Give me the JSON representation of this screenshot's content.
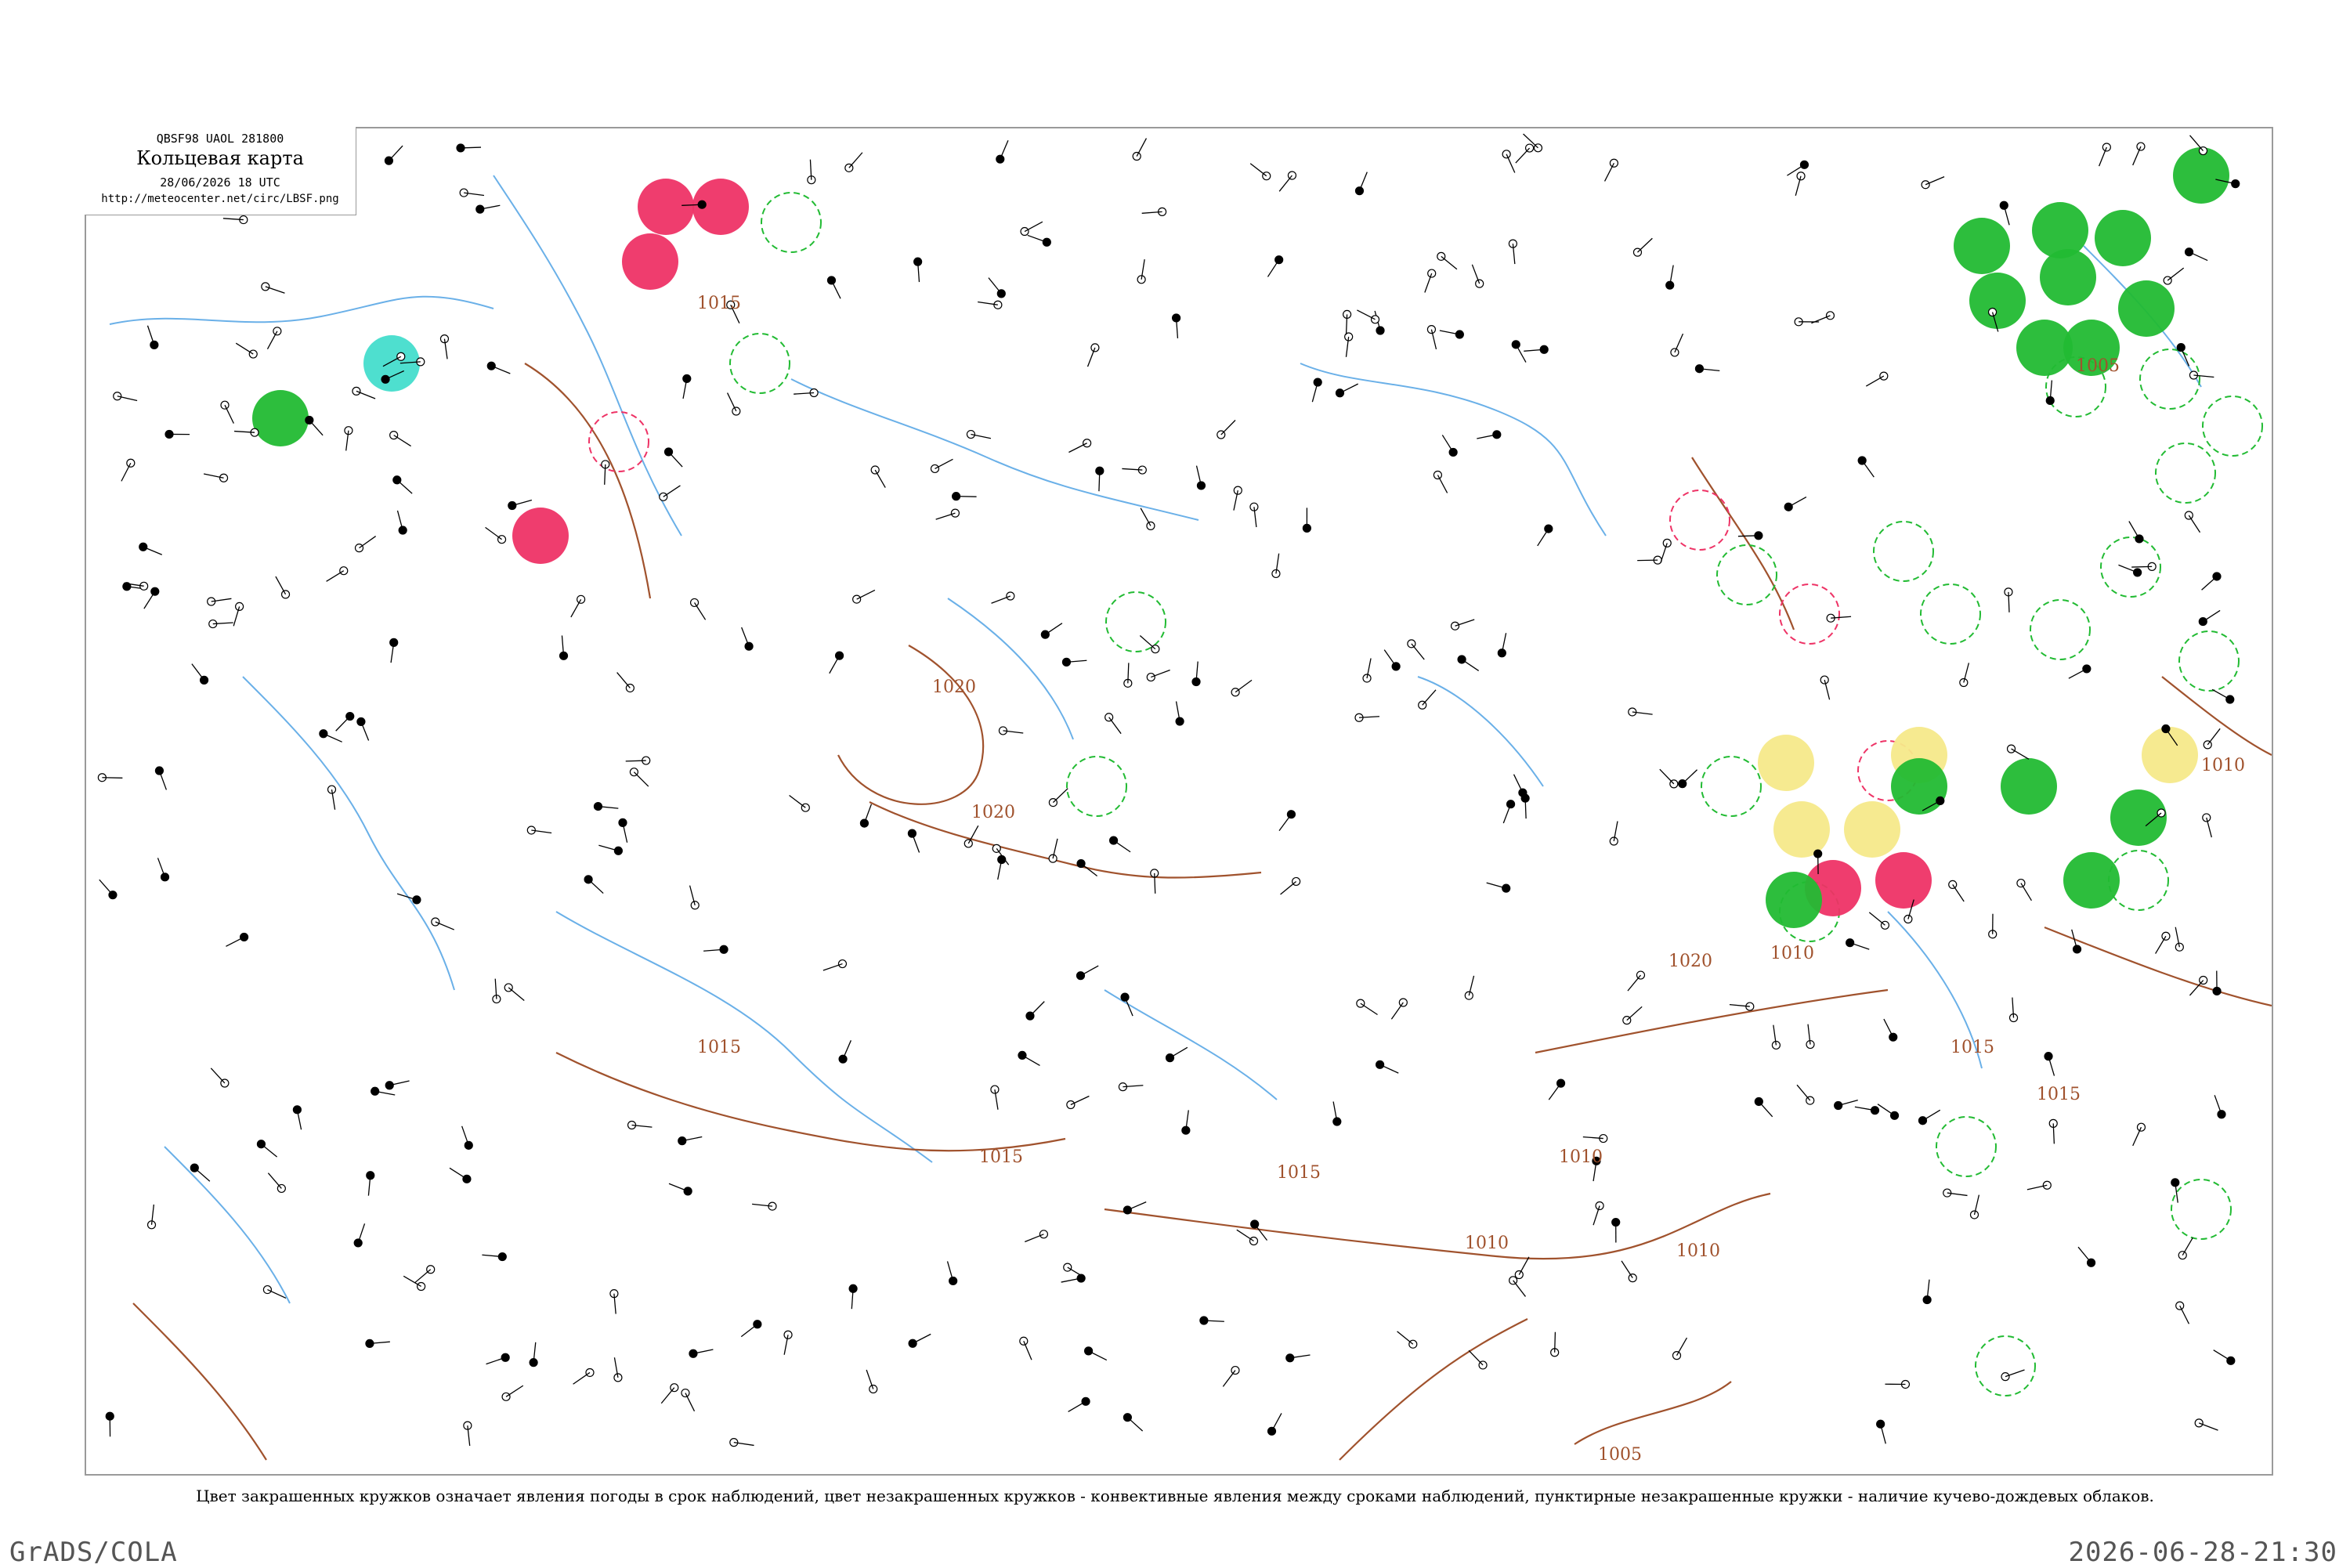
{
  "header": {
    "code": "QBSF98  UAOL  281800",
    "title": "Кольцевая карта",
    "date": "28/06/2026 18 UTC",
    "url": "http://meteocenter.net/circ/LBSF.png"
  },
  "isobar_labels": [
    "1015",
    "1020",
    "1020",
    "1015",
    "1015",
    "1010",
    "1005",
    "1010",
    "1020",
    "1015",
    "1015",
    "1015",
    "1010",
    "1010",
    "1005",
    "1010"
  ],
  "caption": "Цвет закрашенных кружков означает явления погоды в срок наблюдений, цвет незакрашенных кружков - конвективные явления между сроками наблюдений, пунктирные незакрашенные кружки - наличие кучево-дождевых облаков.",
  "footer": {
    "left": "GrADS/COLA",
    "right": "2026-06-28-21:30"
  },
  "colors": {
    "thunderstorm": "#ee3366",
    "rain": "#22bb33",
    "shower": "#f5e98a",
    "fog": "#44ddcc",
    "isobar": "#a0522d",
    "river": "#6ab0e8"
  }
}
